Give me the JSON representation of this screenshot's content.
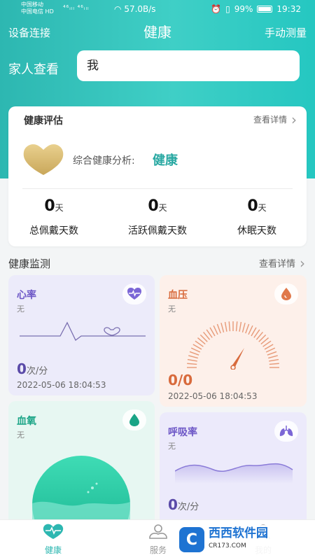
{
  "status_bar": {
    "carrier1": "中国移动",
    "carrier2": "中国电信",
    "hd": "HD",
    "signal": "⁴⁶ᵢₗₗ ⁴⁶ᵢₗₗ",
    "net_speed": "57.0B/s",
    "battery": "99%",
    "time": "19:32"
  },
  "header": {
    "left_link": "设备连接",
    "title": "健康",
    "right_link": "手动测量"
  },
  "family": {
    "label": "家人查看",
    "value": "我"
  },
  "evaluation": {
    "title": "健康评估",
    "more": "查看详情",
    "analysis_label": "综合健康分析:",
    "analysis_value": "健康",
    "stats": [
      {
        "value": "0",
        "unit": "天",
        "label": "总佩戴天数"
      },
      {
        "value": "0",
        "unit": "天",
        "label": "活跃佩戴天数"
      },
      {
        "value": "0",
        "unit": "天",
        "label": "休眠天数"
      }
    ]
  },
  "monitor": {
    "title": "健康监测",
    "more": "查看详情",
    "heart_rate": {
      "title": "心率",
      "status": "无",
      "value": "0",
      "unit": "次/分",
      "time": "2022-05-06 18:04:53",
      "color": "#6c56c6"
    },
    "blood_pressure": {
      "title": "血压",
      "status": "无",
      "value": "0/0",
      "time": "2022-05-06 18:04:53",
      "color": "#d86a3c"
    },
    "blood_oxygen": {
      "title": "血氧",
      "status": "无",
      "color": "#1aa486"
    },
    "respiration": {
      "title": "呼吸率",
      "status": "无",
      "value": "0",
      "unit": "次/分",
      "color": "#6c56c6"
    }
  },
  "tabbar": {
    "tabs": [
      {
        "label": "健康",
        "icon": "heart-icon",
        "active": true
      },
      {
        "label": "服务",
        "icon": "service-icon",
        "active": false
      },
      {
        "label": "我的",
        "icon": "user-icon",
        "active": false
      }
    ],
    "active_color": "#2db7b1"
  },
  "watermark": {
    "logo": "C",
    "name": "西西软件园",
    "site": "CR173.COM"
  }
}
